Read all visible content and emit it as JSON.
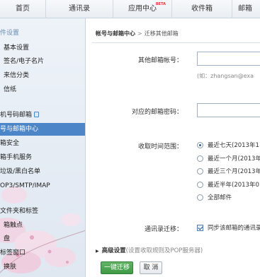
{
  "topnav": {
    "tabs": [
      {
        "label": "首页"
      },
      {
        "label": "通讯录"
      },
      {
        "label": "应用中心",
        "badge": "BETA"
      },
      {
        "label": "收件箱"
      },
      {
        "label": "邮箱"
      }
    ]
  },
  "sidebar": {
    "items": [
      {
        "label": "件设置"
      },
      {
        "label": "基本设置"
      },
      {
        "label": "签名/电子名片"
      },
      {
        "label": "来信分类"
      },
      {
        "label": "信纸"
      },
      {
        "label": "机号码邮箱"
      },
      {
        "label": "号与邮箱中心"
      },
      {
        "label": "箱安全"
      },
      {
        "label": "箱手机服务"
      },
      {
        "label": "垃圾/黑白名单"
      },
      {
        "label": "OP3/SMTP/IMAP"
      },
      {
        "label": "文件夹和标签"
      },
      {
        "label": "箱触点"
      },
      {
        "label": "盘"
      },
      {
        "label": "标签窗口"
      },
      {
        "label": "换肤"
      }
    ]
  },
  "breadcrumb": {
    "parent": "帐号与邮箱中心",
    "separator": ">",
    "current": "迁移其他邮箱"
  },
  "form": {
    "other_account_label": "其他邮箱帐号：",
    "other_account_hint": "(如：zhangsan@exa",
    "password_label": "对应的邮箱密码：",
    "time_range_label": "收取时间范围：",
    "time_options": [
      {
        "label": "最近七天(2013年1",
        "selected": true
      },
      {
        "label": "最近一个月(2013年",
        "selected": false
      },
      {
        "label": "最近三个月(2013年",
        "selected": false
      },
      {
        "label": "最近半年(2013年0",
        "selected": false
      },
      {
        "label": "全部邮件",
        "selected": false
      }
    ],
    "contacts_label": "通讯录迁移：",
    "contacts_checkbox": "同步该邮箱的通讯录",
    "contacts_checked": true
  },
  "advanced": {
    "title": "高级设置",
    "description": "(设置收取规则及POP服务器)"
  },
  "buttons": {
    "migrate": "一键迁移",
    "cancel": "取 消"
  },
  "colors": {
    "active_sidebar": "#4d86c8",
    "primary_button": "#4aa350",
    "section_text": "#6a8db3"
  }
}
